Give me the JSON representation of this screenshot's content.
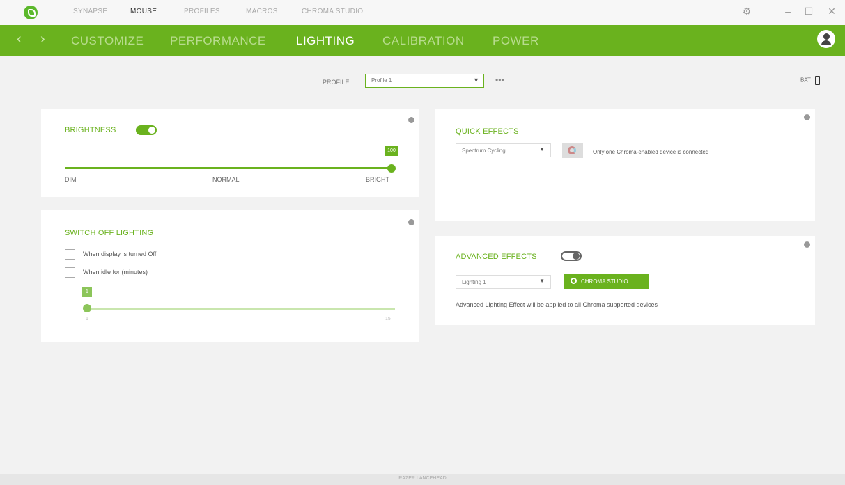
{
  "topbar": {
    "tabs": [
      {
        "label": "SYNAPSE"
      },
      {
        "label": "MOUSE"
      },
      {
        "label": "PROFILES"
      },
      {
        "label": "MACROS"
      },
      {
        "label": "CHROMA STUDIO"
      }
    ],
    "active_tab": "MOUSE"
  },
  "nav": {
    "tabs": [
      {
        "label": "CUSTOMIZE"
      },
      {
        "label": "PERFORMANCE"
      },
      {
        "label": "LIGHTING"
      },
      {
        "label": "CALIBRATION"
      },
      {
        "label": "POWER"
      }
    ],
    "active_tab": "LIGHTING"
  },
  "profile": {
    "label": "PROFILE",
    "value": "Profile 1",
    "more": "•••"
  },
  "battery": {
    "label": "BAT"
  },
  "brightness": {
    "title": "BRIGHTNESS",
    "enabled": true,
    "value": 100,
    "value_label": "100",
    "ticks": [
      "DIM",
      "NORMAL",
      "BRIGHT"
    ]
  },
  "switch_off": {
    "title": "SWITCH OFF LIGHTING",
    "options": [
      {
        "label": "When display is turned Off",
        "checked": false
      },
      {
        "label": "When idle for (minutes)",
        "checked": false
      }
    ],
    "idle_value": "1",
    "idle_min": "1",
    "idle_max": "15"
  },
  "quick_effects": {
    "title": "QUICK EFFECTS",
    "effect": "Spectrum Cycling",
    "note": "Only one Chroma-enabled device is connected"
  },
  "advanced_effects": {
    "title": "ADVANCED EFFECTS",
    "enabled": false,
    "effect": "Lighting 1",
    "button_label": "CHROMA STUDIO",
    "note": "Advanced Lighting Effect will be applied to all Chroma supported devices"
  },
  "footer": {
    "text": "RAZER LANCEHEAD"
  },
  "colors": {
    "accent": "#6ab21e",
    "panel": "#ffffff",
    "background": "#f2f2f2"
  }
}
